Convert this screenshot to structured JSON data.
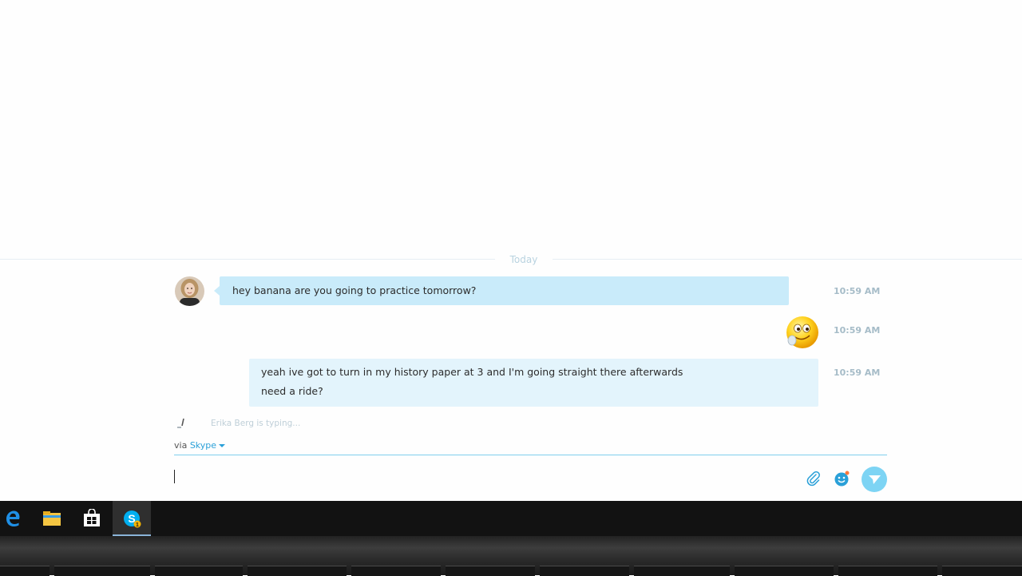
{
  "conversation": {
    "day_label": "Today",
    "messages": [
      {
        "direction": "incoming",
        "text": "hey banana are you going to practice tomorrow?",
        "time": "10:59 AM"
      },
      {
        "direction": "outgoing",
        "type": "emoticon",
        "icon": "tongue-out-emoticon",
        "time": "10:59 AM"
      },
      {
        "direction": "outgoing",
        "lines": [
          "yeah ive got to turn in my history paper at 3 and I'm going straight there afterwards",
          "need a ride?"
        ],
        "time": "10:59 AM"
      }
    ],
    "typing_indicator": "Erika Berg is typing..."
  },
  "compose": {
    "via_prefix": "via",
    "service": "Skype",
    "value": "",
    "placeholder": ""
  },
  "taskbar": {
    "items": [
      {
        "icon": "edge-icon"
      },
      {
        "icon": "file-explorer-icon"
      },
      {
        "icon": "store-icon"
      },
      {
        "icon": "skype-icon",
        "active": true,
        "badge": "1"
      }
    ]
  },
  "colors": {
    "incoming_bubble": "#c9ebfa",
    "outgoing_bubble": "#e3f4fc",
    "accent": "#2aa0d8",
    "send_button": "#7dd4f4",
    "taskbar": "#121212"
  }
}
